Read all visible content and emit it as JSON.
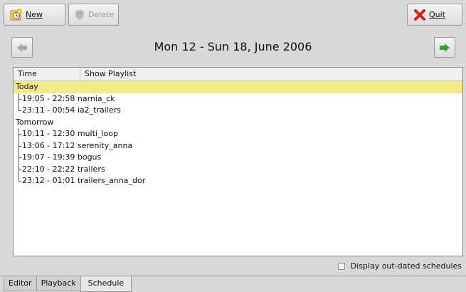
{
  "toolbar": {
    "new_label": "New",
    "delete_label": "Delete",
    "quit_label": "Quit"
  },
  "navigation": {
    "week_title": "Mon 12 - Sun 18, June 2006"
  },
  "schedule": {
    "columns": [
      "Time",
      "Show Playlist"
    ],
    "groups": [
      {
        "label": "Today",
        "selected": true,
        "entries": [
          {
            "text": "19:05 - 22:58 narnia_ck"
          },
          {
            "text": "23:11 - 00:54 ia2_trailers"
          }
        ]
      },
      {
        "label": "Tomorrow",
        "selected": false,
        "entries": [
          {
            "text": "10:11 - 12:30 multi_loop"
          },
          {
            "text": "13:06 - 17:12 serenity_anna"
          },
          {
            "text": "19:07 - 19:39 bogus"
          },
          {
            "text": "22:10 - 22:22 trailers"
          },
          {
            "text": "23:12 - 01:01 trailers_anna_dor"
          }
        ]
      }
    ]
  },
  "options": {
    "outdated_label": "Display out-dated schedules",
    "outdated_checked": false
  },
  "tabs": [
    "Editor",
    "Playback",
    "Schedule"
  ],
  "active_tab": "Schedule",
  "colors": {
    "selection": "#f1e98a",
    "nav_arrow_enabled": "#2ea62e",
    "nav_arrow_disabled": "#a8a8a8"
  }
}
